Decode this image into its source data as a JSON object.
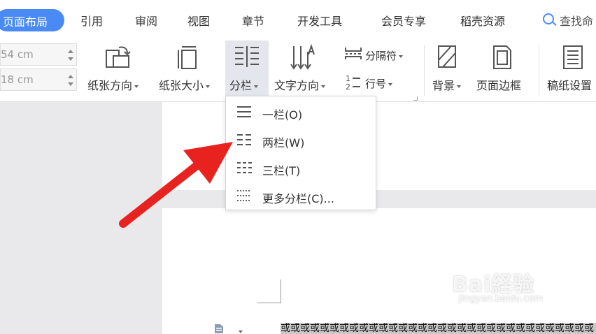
{
  "tabs": [
    {
      "label": "页面布局",
      "active": true
    },
    {
      "label": "引用"
    },
    {
      "label": "审阅"
    },
    {
      "label": "视图"
    },
    {
      "label": "章节"
    },
    {
      "label": "开发工具"
    },
    {
      "label": "会员专享"
    },
    {
      "label": "稻壳资源"
    }
  ],
  "search": {
    "label": "查找命"
  },
  "ribbon": {
    "spin1_value": "54 cm",
    "spin2_value": "18 cm",
    "orientation_label": "纸张方向",
    "size_label": "纸张大小",
    "columns_label": "分栏",
    "text_direction_label": "文字方向",
    "break_label": "分隔符",
    "line_number_label": "行号",
    "background_label": "背景",
    "page_border_label": "页面边框",
    "manuscript_label": "稿纸设置"
  },
  "columns_menu": {
    "items": [
      {
        "label": "一栏(O)",
        "icon": "one-column-icon"
      },
      {
        "label": "两栏(W)",
        "icon": "two-column-icon"
      },
      {
        "label": "三栏(T)",
        "icon": "three-column-icon"
      },
      {
        "label": "更多分栏(C)...",
        "icon": "more-columns-icon"
      }
    ]
  },
  "document": {
    "text": "或或或或或或或或或或或或或或或或或或或或或或或或或或或或或或或或"
  },
  "watermark": {
    "brand": "Bai経验",
    "url": "jingyan.baidu.com"
  },
  "colors": {
    "accent": "#4a8af4",
    "arrow": "#e8231f"
  }
}
